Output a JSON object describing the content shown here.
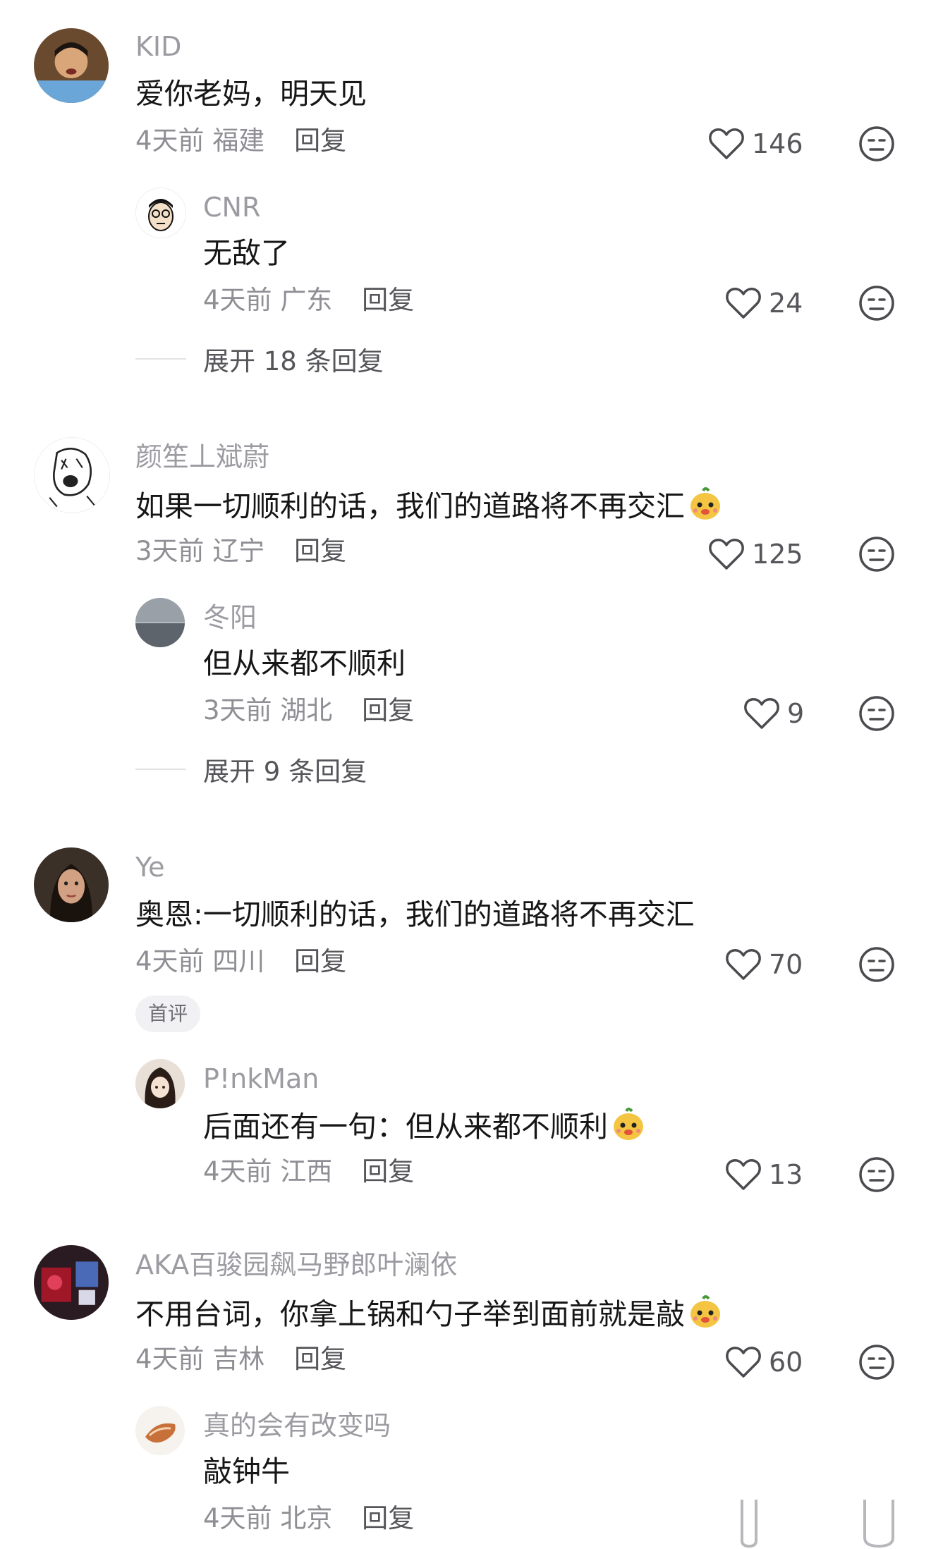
{
  "comments": [
    {
      "user": "KID",
      "text": "爱你老妈，明天见",
      "time": "4天前",
      "location": "福建",
      "reply_label": "回复",
      "likes": "146",
      "avatar_icon": "person-photo-icon",
      "sub_reply": {
        "user": "CNR",
        "text": "无敌了",
        "time": "4天前",
        "location": "广东",
        "reply_label": "回复",
        "likes": "24",
        "avatar_icon": "cartoon-face-icon"
      },
      "expand_label": "展开 18 条回复"
    },
    {
      "user": "颜笙丄斌蔚",
      "text": "如果一切顺利的话，我们的道路将不再交汇",
      "time": "3天前",
      "location": "辽宁",
      "reply_label": "回复",
      "likes": "125",
      "avatar_icon": "sketch-meme-icon",
      "trailing_emoji": "dog-face-emoji",
      "sub_reply": {
        "user": "冬阳",
        "text": "但从来都不顺利",
        "time": "3天前",
        "location": "湖北",
        "reply_label": "回复",
        "likes": "9",
        "avatar_icon": "sea-horizon-icon"
      },
      "expand_label": "展开 9 条回复"
    },
    {
      "user": "Ye",
      "text": "奥恩:一切顺利的话，我们的道路将不再交汇",
      "time": "4天前",
      "location": "四川",
      "reply_label": "回复",
      "likes": "70",
      "avatar_icon": "portrait-photo-icon",
      "badge": "首评",
      "sub_reply": {
        "user": "P!nkMan",
        "text": "后面还有一句：但从来都不顺利",
        "time": "4天前",
        "location": "江西",
        "reply_label": "回复",
        "likes": "13",
        "avatar_icon": "anime-girl-icon",
        "trailing_emoji": "dog-face-emoji"
      }
    },
    {
      "user": "AKA百骏园飙马野郎叶澜依",
      "text": "不用台词，你拿上锅和勺子举到面前就是敲",
      "time": "4天前",
      "location": "吉林",
      "reply_label": "回复",
      "likes": "60",
      "avatar_icon": "red-scene-icon",
      "trailing_emoji": "dog-face-emoji",
      "sub_reply": {
        "user": "真的会有改变吗",
        "text": "敲钟牛",
        "time": "4天前",
        "location": "北京",
        "reply_label": "回复",
        "avatar_icon": "food-photo-icon"
      }
    }
  ],
  "colors": {
    "name": "#9b9ba1",
    "text": "#161616",
    "meta": "#8e8e94",
    "icon": "#4a4a4f"
  }
}
